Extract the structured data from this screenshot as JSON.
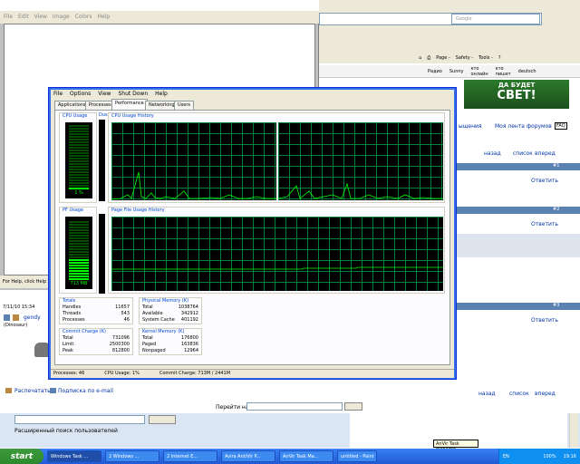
{
  "paint": {
    "menu": [
      "File",
      "Edit",
      "View",
      "Image",
      "Colors",
      "Help"
    ],
    "status": "For Help, click Help To"
  },
  "ie": {
    "search_placeholder": "Google",
    "commands": [
      "Page -",
      "Safety -",
      "Tools -"
    ],
    "links": [
      "Радио",
      "Sunny",
      "кто онлайн",
      "кто пишет",
      "deutsch"
    ],
    "banner_small": "ДА БУДЕТ",
    "banner_big": "СВЕТ!",
    "forum_links": [
      "ыщения",
      "Моя лента форумов",
      "FAQ"
    ],
    "nav": [
      "назад",
      "список",
      "вперед"
    ],
    "reply": "Ответить",
    "post_nums": [
      "#1",
      "#2",
      "#3"
    ],
    "post_date": "7/11/10 15:34",
    "user": "gendy",
    "user_title": "(Dinosaur)",
    "print": "Распечатать",
    "subscribe": "Подписка по e-mail",
    "goto": "Перейти на",
    "adv_search": "Расширенный поиск пользователей"
  },
  "tm": {
    "menu": [
      "File",
      "Options",
      "View",
      "Shut Down",
      "Help"
    ],
    "tabs": [
      "Applications",
      "Processes",
      "Performance",
      "Networking",
      "Users"
    ],
    "active_tab": "Performance",
    "cpu_usage_label": "CPU Usage",
    "cpu_usage_value": "1 %",
    "cpu_usage_fraction": 0.01,
    "cpu_hist_label": "CPU Usage History",
    "pf_usage_label": "PF Usage",
    "pf_usage_value": "713 MB",
    "pf_usage_fraction": 0.35,
    "pf_hist_label": "Page File Usage History",
    "totals": {
      "label": "Totals",
      "rows": [
        [
          "Handles",
          "11657"
        ],
        [
          "Threads",
          "543"
        ],
        [
          "Processes",
          "46"
        ]
      ]
    },
    "physical": {
      "label": "Physical Memory (K)",
      "rows": [
        [
          "Total",
          "1038764"
        ],
        [
          "Available",
          "342912"
        ],
        [
          "System Cache",
          "401192"
        ]
      ]
    },
    "commit": {
      "label": "Commit Charge (K)",
      "rows": [
        [
          "Total",
          "731096"
        ],
        [
          "Limit",
          "2500300"
        ],
        [
          "Peak",
          "812800"
        ]
      ]
    },
    "kernel": {
      "label": "Kernel Memory (K)",
      "rows": [
        [
          "Total",
          "176800"
        ],
        [
          "Paged",
          "163836"
        ],
        [
          "Nonpaged",
          "12964"
        ]
      ]
    },
    "status": [
      "Processes: 46",
      "CPU Usage: 1%",
      "Commit Charge: 713M / 2441M"
    ],
    "stub_label": "Dus"
  },
  "taskbar": {
    "start": "start",
    "buttons": [
      "Windows Task ...",
      "2 Windows ...",
      "2 Internet E...",
      "Avira AntiVir P...",
      "AnVir Task Ma...",
      "untitled - Paint"
    ],
    "tray_lang": "EN",
    "clock": "19:16",
    "zoom": "100%"
  },
  "tooltip": "AnVir Task Manager"
}
